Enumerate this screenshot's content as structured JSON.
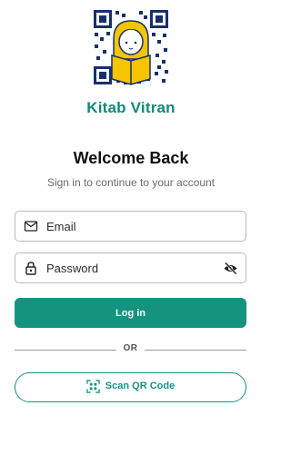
{
  "brand": {
    "app_name": "Kitab Vitran",
    "primary_color": "#14937f",
    "logo_icon": "qr-code-with-reading-girl-logo"
  },
  "header": {
    "title": "Welcome Back",
    "subtitle": "Sign in to continue to your account"
  },
  "form": {
    "email": {
      "placeholder": "Email",
      "value": "",
      "icon": "mail-icon"
    },
    "password": {
      "placeholder": "Password",
      "value": "",
      "icon": "lock-icon",
      "toggle_icon": "eye-off-icon"
    }
  },
  "actions": {
    "login_label": "Log in",
    "divider_label": "OR",
    "scan_label": "Scan QR Code",
    "scan_icon": "qr-scan-icon"
  }
}
